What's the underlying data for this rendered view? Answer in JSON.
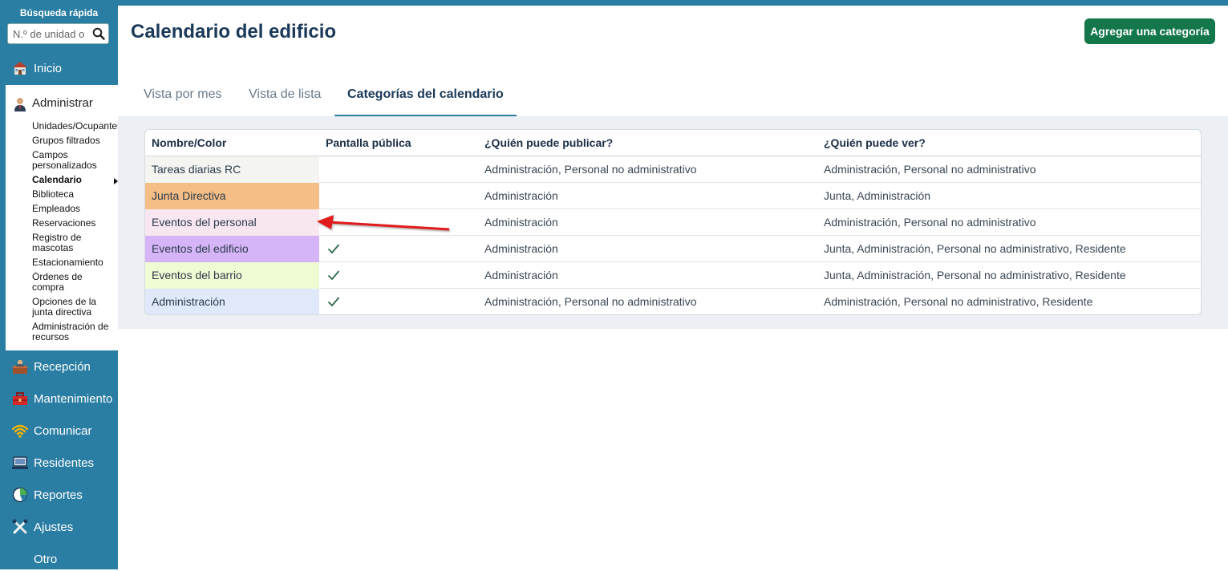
{
  "sidebar": {
    "quick_search_label": "Búsqueda rápida",
    "quick_search_placeholder": "N.º de unidad o",
    "nav_top": [
      {
        "label": "Inicio",
        "icon": "home-icon"
      }
    ],
    "admin": {
      "label": "Administrar",
      "icon": "admin-user-icon",
      "items": [
        {
          "label": "Unidades/Ocupantes"
        },
        {
          "label": "Grupos filtrados"
        },
        {
          "label": "Campos personalizados"
        },
        {
          "label": "Calendario",
          "active": true
        },
        {
          "label": "Biblioteca"
        },
        {
          "label": "Empleados"
        },
        {
          "label": "Reservaciones"
        },
        {
          "label": "Registro de mascotas"
        },
        {
          "label": "Estacionamiento"
        },
        {
          "label": "Órdenes de compra"
        },
        {
          "label": "Opciones de la junta directiva"
        },
        {
          "label": "Administración de recursos"
        }
      ]
    },
    "nav_bottom": [
      {
        "label": "Recepción",
        "icon": "front-desk-icon"
      },
      {
        "label": "Mantenimiento",
        "icon": "toolbox-icon"
      },
      {
        "label": "Comunicar",
        "icon": "wifi-icon"
      },
      {
        "label": "Residentes",
        "icon": "residents-icon"
      },
      {
        "label": "Reportes",
        "icon": "pie-chart-icon"
      },
      {
        "label": "Ajustes",
        "icon": "tools-icon"
      },
      {
        "label": "Otro",
        "icon": ""
      }
    ]
  },
  "header": {
    "title": "Calendario del edificio",
    "add_button": "Agregar una categoría"
  },
  "tabs": [
    {
      "label": "Vista por mes",
      "active": false
    },
    {
      "label": "Vista de lista",
      "active": false
    },
    {
      "label": "Categorías del calendario",
      "active": true
    }
  ],
  "table": {
    "columns": [
      "Nombre/Color",
      "Pantalla pública",
      "¿Quién puede publicar?",
      "¿Quién puede ver?"
    ],
    "rows": [
      {
        "name": "Tareas diarias RC",
        "color": "#f4f5f1",
        "public": false,
        "publish": "Administración, Personal no administrativo",
        "view": "Administración, Personal no administrativo"
      },
      {
        "name": "Junta Directiva",
        "color": "#f5be87",
        "public": false,
        "publish": "Administración",
        "view": "Junta, Administración"
      },
      {
        "name": "Eventos del personal",
        "color": "#f8e7f1",
        "public": false,
        "publish": "Administración",
        "view": "Administración, Personal no administrativo"
      },
      {
        "name": "Eventos del edificio",
        "color": "#d5b5f7",
        "public": true,
        "publish": "Administración",
        "view": "Junta, Administración, Personal no administrativo, Residente"
      },
      {
        "name": "Eventos del barrio",
        "color": "#effbd3",
        "public": true,
        "publish": "Administración",
        "view": "Junta, Administración, Personal no administrativo, Residente"
      },
      {
        "name": "Administración",
        "color": "#dfe9fa",
        "public": true,
        "publish": "Administración, Personal no administrativo",
        "view": "Administración, Personal no administrativo, Residente"
      }
    ]
  },
  "colors": {
    "sidebar": "#2a7ea3",
    "primary_button": "#13774b",
    "check": "#2e6b4a",
    "annotation_arrow": "#e01b1b"
  }
}
